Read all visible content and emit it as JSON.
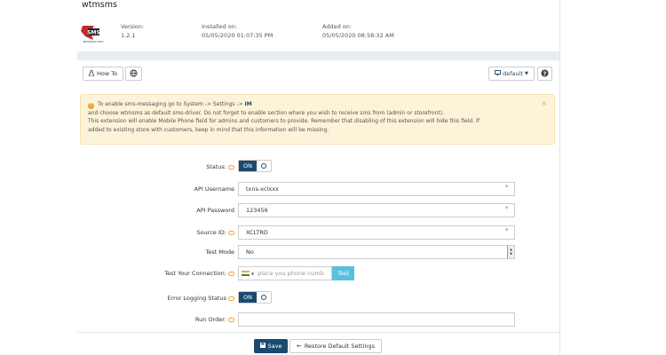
{
  "header": {
    "title": "wtmsms",
    "logo_text": "SMS",
    "logo_caption": "wtmsms.com",
    "version_label": "Version:",
    "version_value": "1.2.1",
    "installed_label": "Installed on:",
    "installed_value": "05/05/2020 01:07:35 PM",
    "added_label": "Added on:",
    "added_value": "05/05/2020 08:58:32 AM"
  },
  "toolbar": {
    "howto_label": "How To",
    "theme_label": "default"
  },
  "alert": {
    "line1_prefix": "To enable sms-messaging go to System -> Settings -> ",
    "line1_bold": "IM",
    "line2": "and choose wtmsms as default sms-driver. Do not forget to enable section where you wish to receive sms from (admin or storefront).",
    "line3": "This extension will enable Mobile Phone field for admins and customers to provide. Remember that disabling of this extension will hide this field. If",
    "line4": "added to existing store with customers, keep in mind that this information will be missing.",
    "close": "×"
  },
  "form": {
    "status_label": "Status:",
    "status_on": "ON",
    "api_user_label": "API Username",
    "api_user_value": "txns-xclxxx",
    "api_pass_label": "API Password",
    "api_pass_value": "123456",
    "source_label": "Source ID:",
    "source_value": "XCLTRD",
    "test_mode_label": "Test Mode",
    "test_mode_value": "No",
    "test_conn_label": "Test Your Connection:",
    "phone_placeholder": "place you phone numb",
    "test_button": "Test",
    "error_log_label": "Error Logging Status",
    "error_log_on": "ON",
    "run_order_label": "Run Order:",
    "run_order_value": "",
    "required_mark": "*"
  },
  "footer": {
    "save_label": "Save",
    "restore_label": "Restore Default Settings"
  },
  "colors": {
    "primary": "#1b4a6f",
    "info": "#5bc0de",
    "warning_bg": "#fdf3d9",
    "required": "#d9534f"
  }
}
